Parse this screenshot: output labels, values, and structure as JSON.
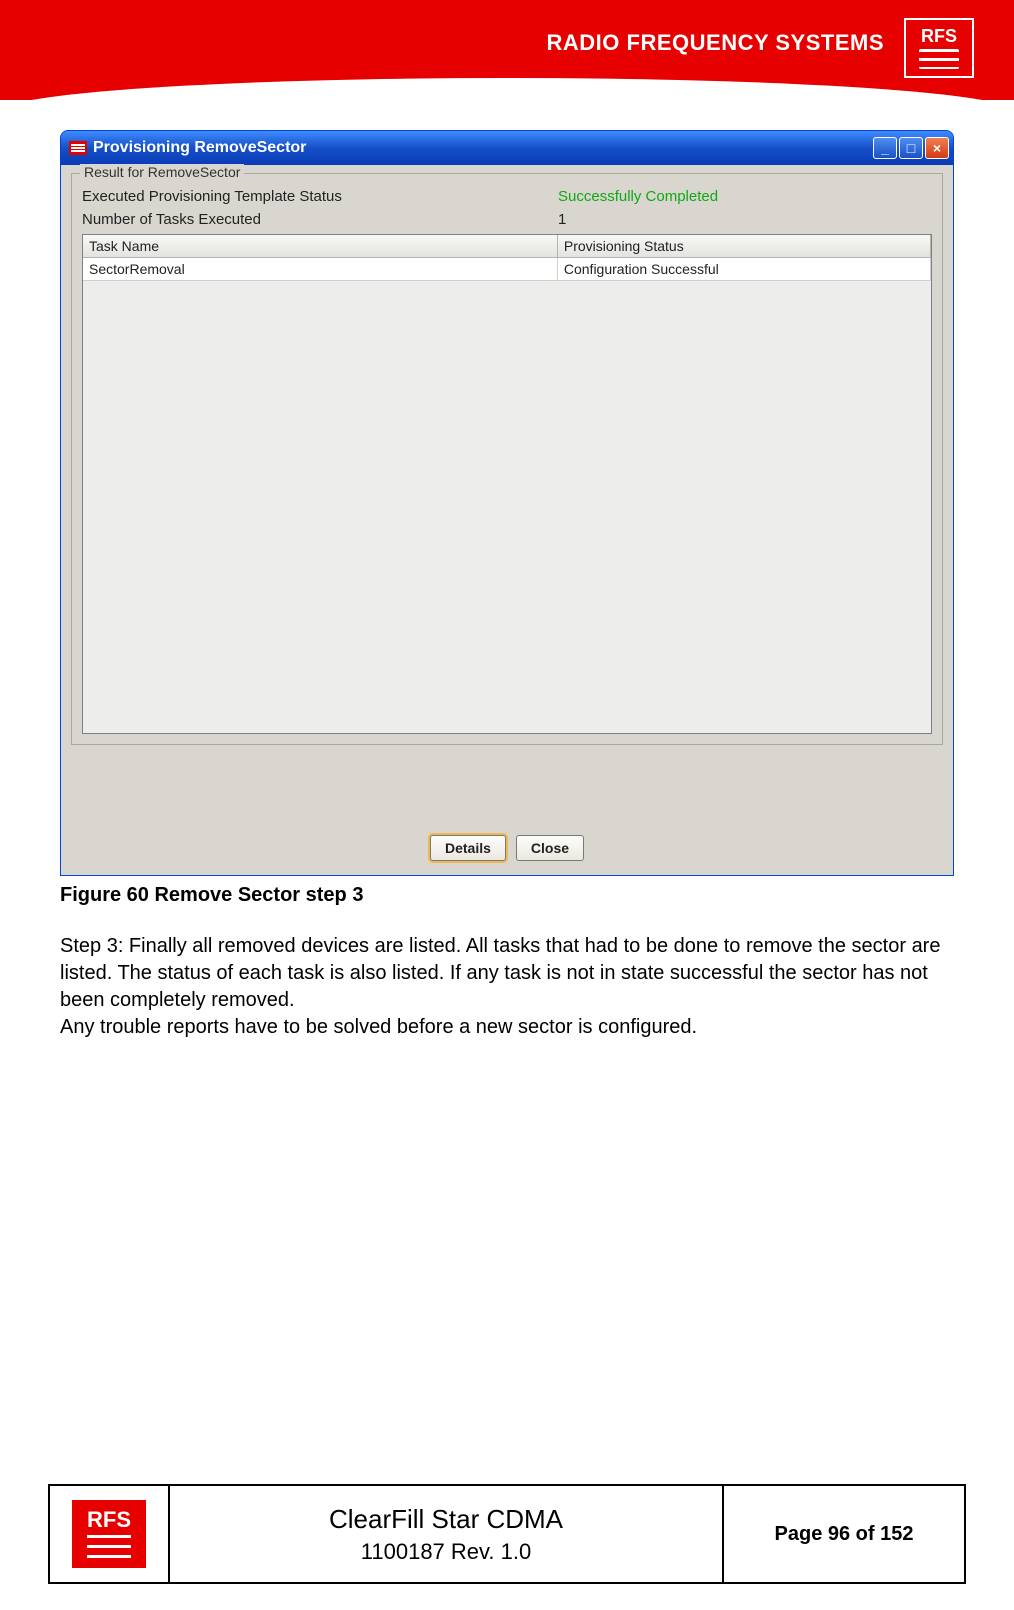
{
  "header": {
    "brand_text": "RADIO FREQUENCY SYSTEMS",
    "logo_text": "RFS"
  },
  "window": {
    "title": "Provisioning RemoveSector",
    "fieldset_legend": "Result for RemoveSector",
    "rows": [
      {
        "label": "Executed Provisioning Template Status",
        "value": "Successfully Completed",
        "success": true
      },
      {
        "label": "Number of Tasks Executed",
        "value": "1",
        "success": false
      }
    ],
    "table": {
      "headers": [
        "Task Name",
        "Provisioning Status"
      ],
      "rows": [
        [
          "SectorRemoval",
          "Configuration Successful"
        ]
      ]
    },
    "buttons": {
      "details": "Details",
      "close": "Close"
    }
  },
  "figure_caption": "Figure 60 Remove Sector step 3",
  "step_text_1": "Step 3: Finally all removed devices are listed. All tasks that had to be done to remove the sector are listed. The status of each task is also listed. If any task is not in state successful the sector has not been completely removed.",
  "step_text_2": "Any trouble reports have to be solved before a new sector is configured.",
  "footer": {
    "logo_text": "RFS",
    "title": "ClearFill Star CDMA",
    "rev": "1100187 Rev. 1.0",
    "page": "Page 96 of 152"
  }
}
